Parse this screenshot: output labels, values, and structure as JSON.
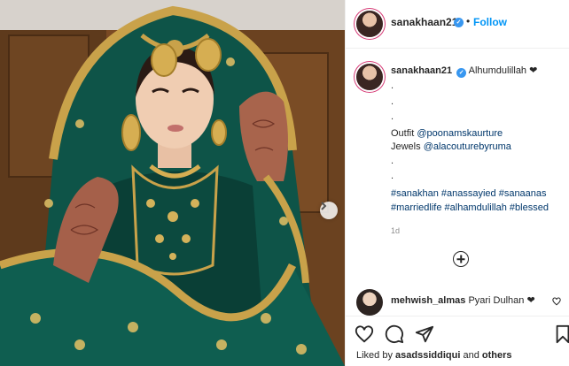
{
  "post_header": {
    "username": "sanakhaan21",
    "separator": "•",
    "follow_label": "Follow"
  },
  "caption": {
    "username": "sanakhaan21",
    "first_line": "Alhumdulillah ❤",
    "dots": [
      ".",
      ".",
      "."
    ],
    "outfit_label": "Outfit",
    "outfit_mention": "@poonamskaurture",
    "jewels_label": "Jewels",
    "jewels_mention": "@alacouturebyruma",
    "dots2": [
      ".",
      "."
    ],
    "hashtags_line1": "#sanakhan #anassayied #sanaanas",
    "hashtags_line2": "#marriedlife #alhamdulillah #blessed",
    "time": "1d"
  },
  "comment": {
    "username": "mehwish_almas",
    "text": "Pyari Dulhan ❤"
  },
  "likes": {
    "prefix": "Liked by",
    "user": "asadssiddiqui",
    "connector": "and",
    "others": "others"
  },
  "icons": {
    "verified": "verified-badge-icon",
    "next": "chevron-right-icon",
    "like": "heart-icon",
    "comment": "comment-icon",
    "share": "paper-plane-icon",
    "save": "bookmark-icon",
    "more": "plus-circle-icon"
  },
  "colors": {
    "accent": "#0095f6",
    "link": "#00376b",
    "verified": "#3897f0",
    "muted": "#8e8e8e",
    "dupatta_green": "#0f5a4c",
    "gold": "#c9a24a"
  }
}
